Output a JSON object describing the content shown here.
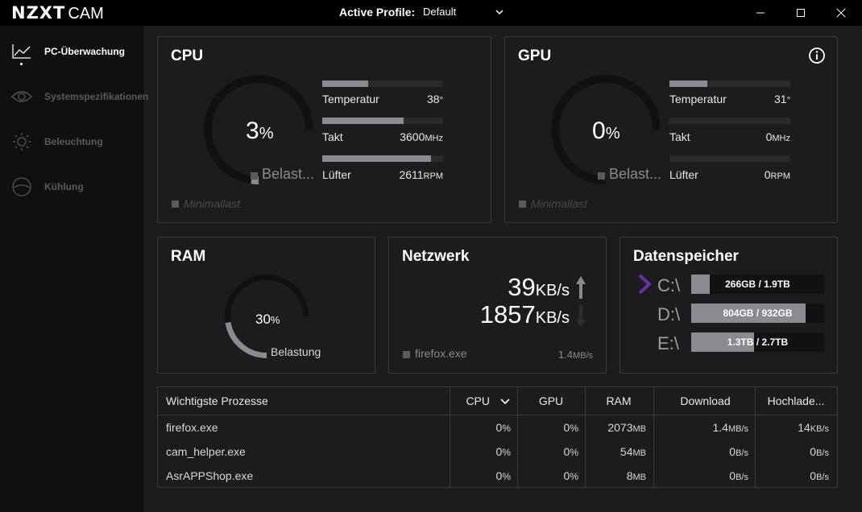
{
  "app": {
    "brand": "NZXT",
    "name": "CAM",
    "profile_label": "Active Profile:",
    "profile_value": "Default"
  },
  "sidebar": {
    "items": [
      {
        "label": "PC-Überwachung",
        "icon": "chart-line-icon",
        "active": true
      },
      {
        "label": "Systemspezifikationen",
        "icon": "eye-icon",
        "active": false
      },
      {
        "label": "Beleuchtung",
        "icon": "sun-icon",
        "active": false
      },
      {
        "label": "Kühlung",
        "icon": "fan-icon",
        "active": false
      }
    ]
  },
  "cpu": {
    "title": "CPU",
    "load_value": "3",
    "load_unit": "%",
    "load_fraction": 0.03,
    "load_label": "Belast...",
    "min_label": "Minimallast",
    "stats": [
      {
        "label": "Temperatur",
        "value": "38",
        "unit": "°",
        "fraction": 0.38
      },
      {
        "label": "Takt",
        "value": "3600",
        "unit": "MHz",
        "fraction": 0.67
      },
      {
        "label": "Lüfter",
        "value": "2611",
        "unit": "RPM",
        "fraction": 0.9
      }
    ]
  },
  "gpu": {
    "title": "GPU",
    "load_value": "0",
    "load_unit": "%",
    "load_fraction": 0.0,
    "load_label": "Belast...",
    "min_label": "Minimallast",
    "stats": [
      {
        "label": "Temperatur",
        "value": "31",
        "unit": "°",
        "fraction": 0.31
      },
      {
        "label": "Takt",
        "value": "0",
        "unit": "MHz",
        "fraction": 0
      },
      {
        "label": "Lüfter",
        "value": "0",
        "unit": "RPM",
        "fraction": 0
      }
    ]
  },
  "ram": {
    "title": "RAM",
    "value": "30",
    "unit": "%",
    "fraction": 0.3,
    "label": "Belastung"
  },
  "network": {
    "title": "Netzwerk",
    "upload_value": "39",
    "download_value": "1857",
    "unit": "KB/s",
    "process": "firefox.exe",
    "process_rate": "1.4",
    "process_rate_unit": "MB/s"
  },
  "storage": {
    "title": "Datenspeicher",
    "drives": [
      {
        "label": "C:\\",
        "text_used": "266GB",
        "text_total": "1.9TB",
        "fraction": 0.14,
        "selected": true
      },
      {
        "label": "D:\\",
        "text_used": "804GB",
        "text_total": "932GB",
        "fraction": 0.86,
        "selected": false
      },
      {
        "label": "E:\\",
        "text_used": "1.3TB",
        "text_total": "2.7TB",
        "fraction": 0.47,
        "selected": false
      }
    ]
  },
  "processes": {
    "headers": [
      "Wichtigste Prozesse",
      "CPU",
      "GPU",
      "RAM",
      "Download",
      "Hochlade..."
    ],
    "rows": [
      {
        "name": "firefox.exe",
        "cpu": "0",
        "gpu": "0",
        "ram": "2073",
        "ram_unit": "MB",
        "down": "1.4",
        "down_unit": "MB/s",
        "up": "14",
        "up_unit": "KB/s"
      },
      {
        "name": "cam_helper.exe",
        "cpu": "0",
        "gpu": "0",
        "ram": "54",
        "ram_unit": "MB",
        "down": "0",
        "down_unit": "B/s",
        "up": "0",
        "up_unit": "B/s"
      },
      {
        "name": "AsrAPPShop.exe",
        "cpu": "0",
        "gpu": "0",
        "ram": "8",
        "ram_unit": "MB",
        "down": "0",
        "down_unit": "B/s",
        "up": "0",
        "up_unit": "B/s"
      }
    ],
    "pct_unit": "%"
  },
  "colors": {
    "accent": "#6a2fa0",
    "bar_fill": "#8a8a90",
    "track": "#2a2a2c"
  }
}
